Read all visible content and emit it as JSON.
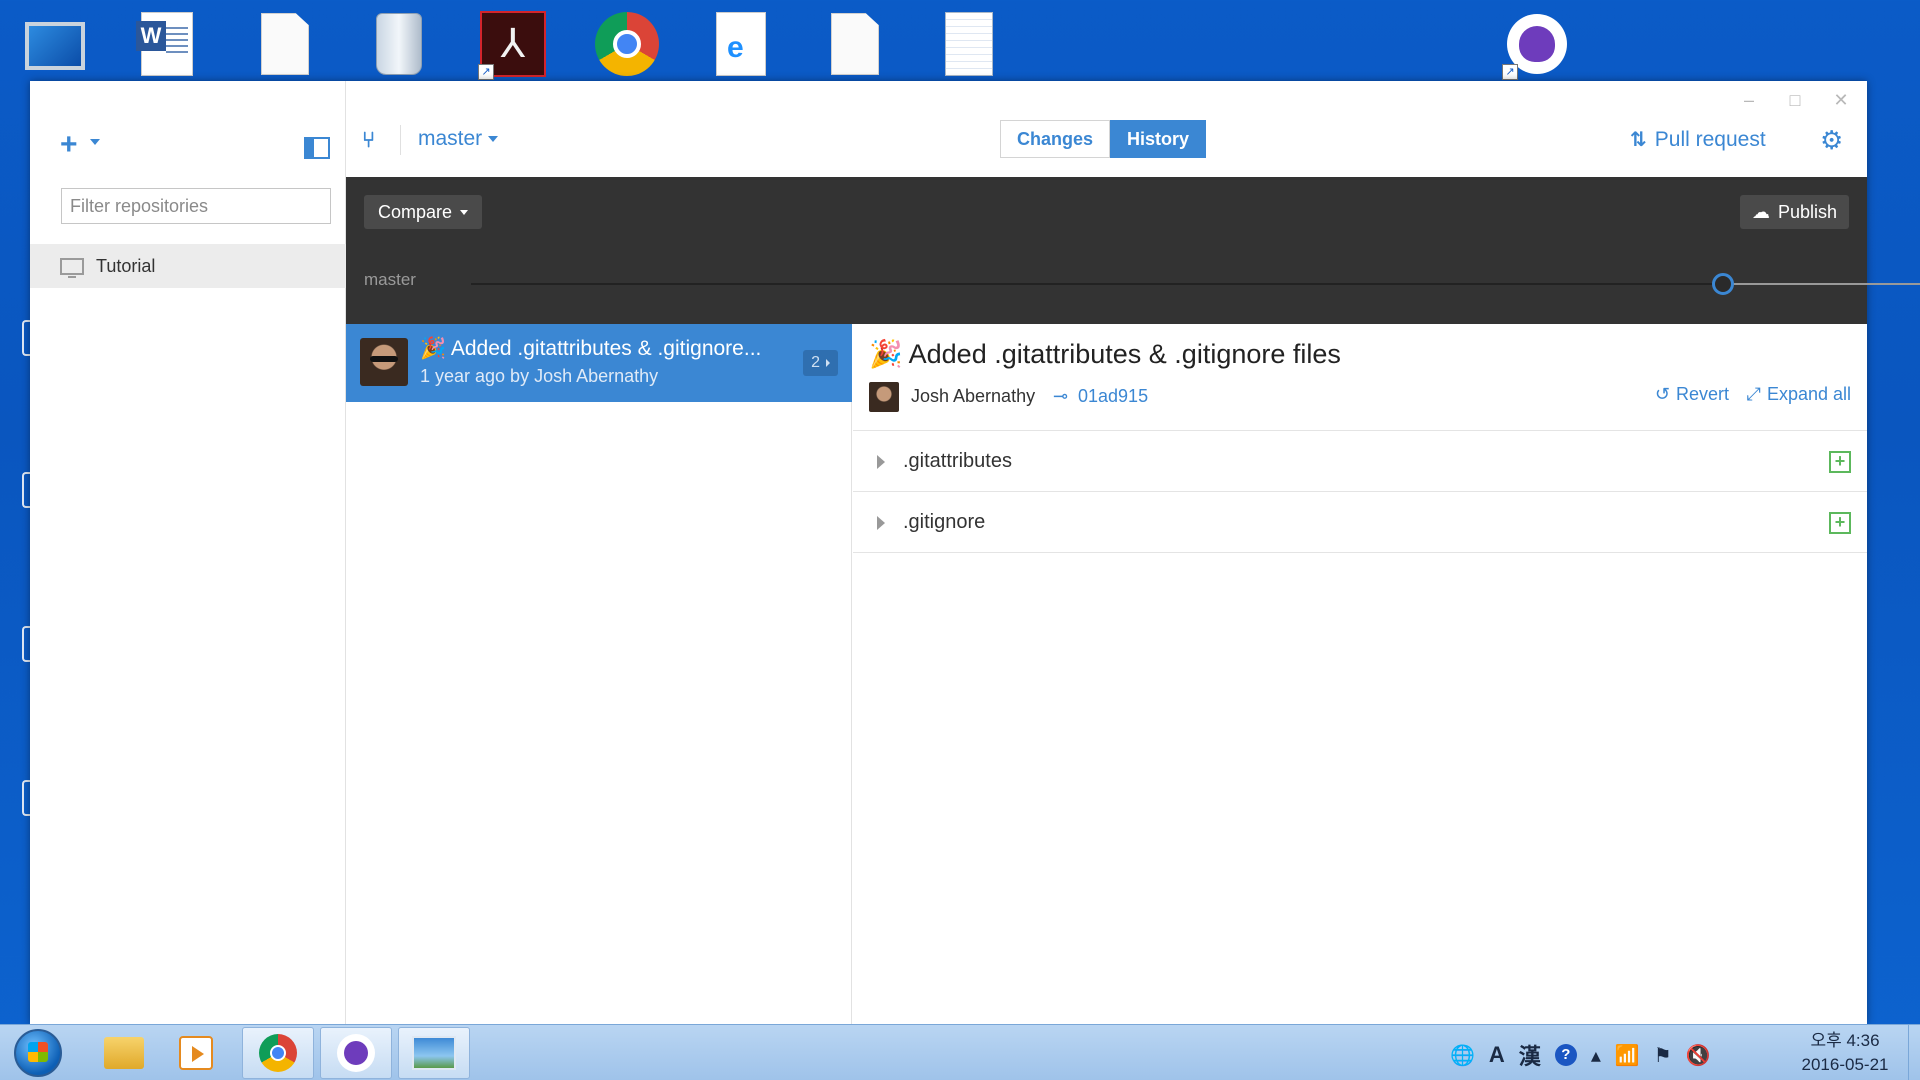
{
  "desktop": {
    "icons": [
      {
        "name": "computer-desktop-icon",
        "label": "",
        "has_shortcut": false
      },
      {
        "name": "word-document-desktop-icon",
        "label": "",
        "has_shortcut": false
      },
      {
        "name": "blank-document-desktop-icon",
        "label": "",
        "has_shortcut": false
      },
      {
        "name": "recycle-bin-desktop-icon",
        "label": "",
        "has_shortcut": false
      },
      {
        "name": "acrobat-reader-desktop-icon",
        "label": "",
        "has_shortcut": true
      },
      {
        "name": "chrome-desktop-icon",
        "label": "",
        "has_shortcut": false
      },
      {
        "name": "ie-document-desktop-icon",
        "label": "",
        "has_shortcut": false
      },
      {
        "name": "blank-document-desktop-icon-2",
        "label": "",
        "has_shortcut": false
      },
      {
        "name": "notepad-document-desktop-icon",
        "label": "",
        "has_shortcut": false
      },
      {
        "name": "github-desktop-icon",
        "label": "",
        "has_shortcut": true
      }
    ]
  },
  "app": {
    "window_controls": {
      "minimize": "–",
      "maximize": "□",
      "close": "✕"
    },
    "sidebar": {
      "add_icon": "+",
      "filter_placeholder": "Filter repositories",
      "repositories": [
        {
          "name": "Tutorial",
          "icon": "monitor-icon"
        }
      ]
    },
    "header": {
      "branch_icon": "branch-icon",
      "branch_name": "master",
      "tabs": [
        {
          "label": "Changes",
          "active": false
        },
        {
          "label": "History",
          "active": true
        }
      ],
      "pull_request_label": "Pull request",
      "settings_icon": "gear-icon"
    },
    "toolbar": {
      "compare_label": "Compare",
      "publish_label": "Publish",
      "timeline_branch": "master"
    },
    "commits": [
      {
        "emoji": "🎉",
        "title": "Added .gitattributes & .gitignore...",
        "meta": "1 year ago by Josh Abernathy",
        "files_count": "2",
        "selected": true
      }
    ],
    "detail": {
      "emoji": "🎉",
      "title": "Added .gitattributes & .gitignore files",
      "author": "Josh Abernathy",
      "sha": "01ad915",
      "revert_label": "Revert",
      "expand_label": "Expand all",
      "files": [
        {
          "name": ".gitattributes",
          "status": "added"
        },
        {
          "name": ".gitignore",
          "status": "added"
        }
      ]
    },
    "colors": {
      "accent": "#3b87d3",
      "toolbar_bg": "#333333",
      "added": "#5cb85c"
    }
  },
  "taskbar": {
    "items": [
      "start-button",
      "file-explorer",
      "media-player",
      "chrome",
      "github-desktop",
      "photo-viewer"
    ],
    "tray": {
      "ime_mode": "A",
      "ime_hanja": "漢",
      "help": "?",
      "time": "오후 4:36",
      "date": "2016-05-21"
    }
  }
}
